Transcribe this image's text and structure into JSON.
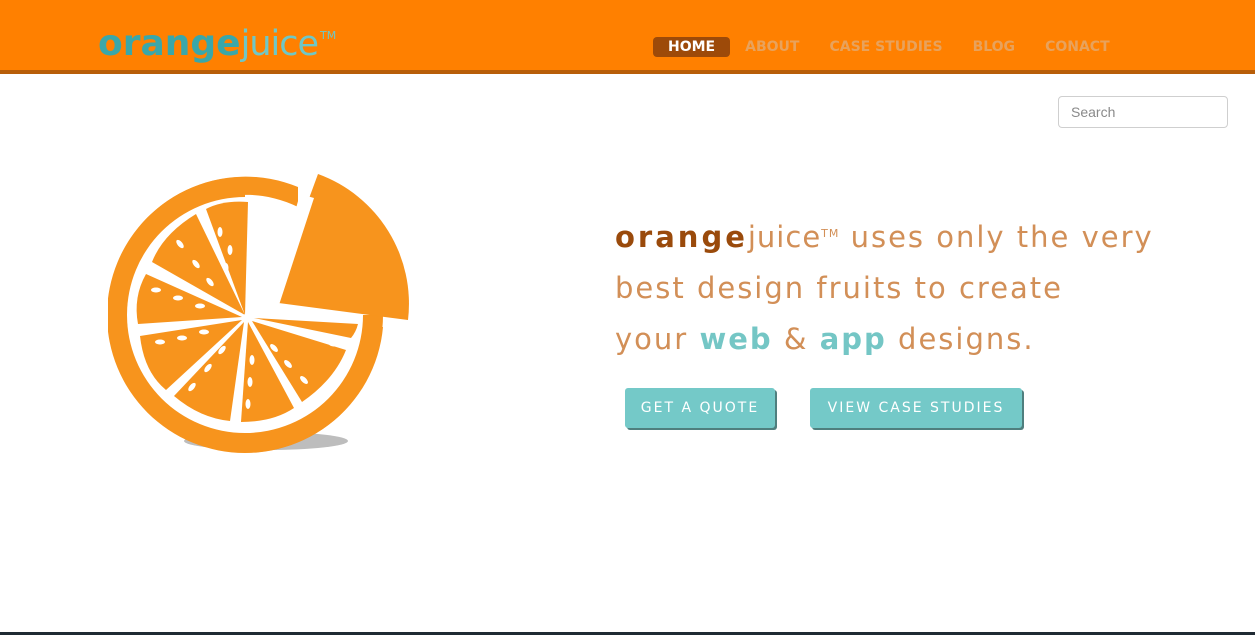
{
  "brand": {
    "logo_bold": "orange",
    "logo_light": "juice",
    "logo_tm": "TM"
  },
  "nav": {
    "items": [
      {
        "label": "HOME",
        "active": true
      },
      {
        "label": "ABOUT",
        "active": false
      },
      {
        "label": "CASE STUDIES",
        "active": false
      },
      {
        "label": "BLOG",
        "active": false
      },
      {
        "label": "CONACT",
        "active": false
      }
    ]
  },
  "search": {
    "placeholder": "Search",
    "value": ""
  },
  "hero": {
    "brand_bold": "orange",
    "brand_light": "juice",
    "brand_tm": "TM",
    "line1_rest": " uses only the very",
    "line2": "best design fruits to create",
    "line3_start": "your ",
    "web": "web",
    "amp": " & ",
    "app": "app",
    "line3_end": " designs.",
    "image_icon": "orange-slice-icon"
  },
  "buttons": {
    "quote": "GET A QUOTE",
    "case_studies": "VIEW CASE STUDIES"
  },
  "colors": {
    "header": "#ff8000",
    "header_border": "#b85e09",
    "nav_active_bg": "#9d4a09",
    "accent_teal": "#74c9c8",
    "orange_fruit": "#f7941d",
    "text_orange": "#d28f57",
    "text_brown": "#9a4a0b"
  }
}
